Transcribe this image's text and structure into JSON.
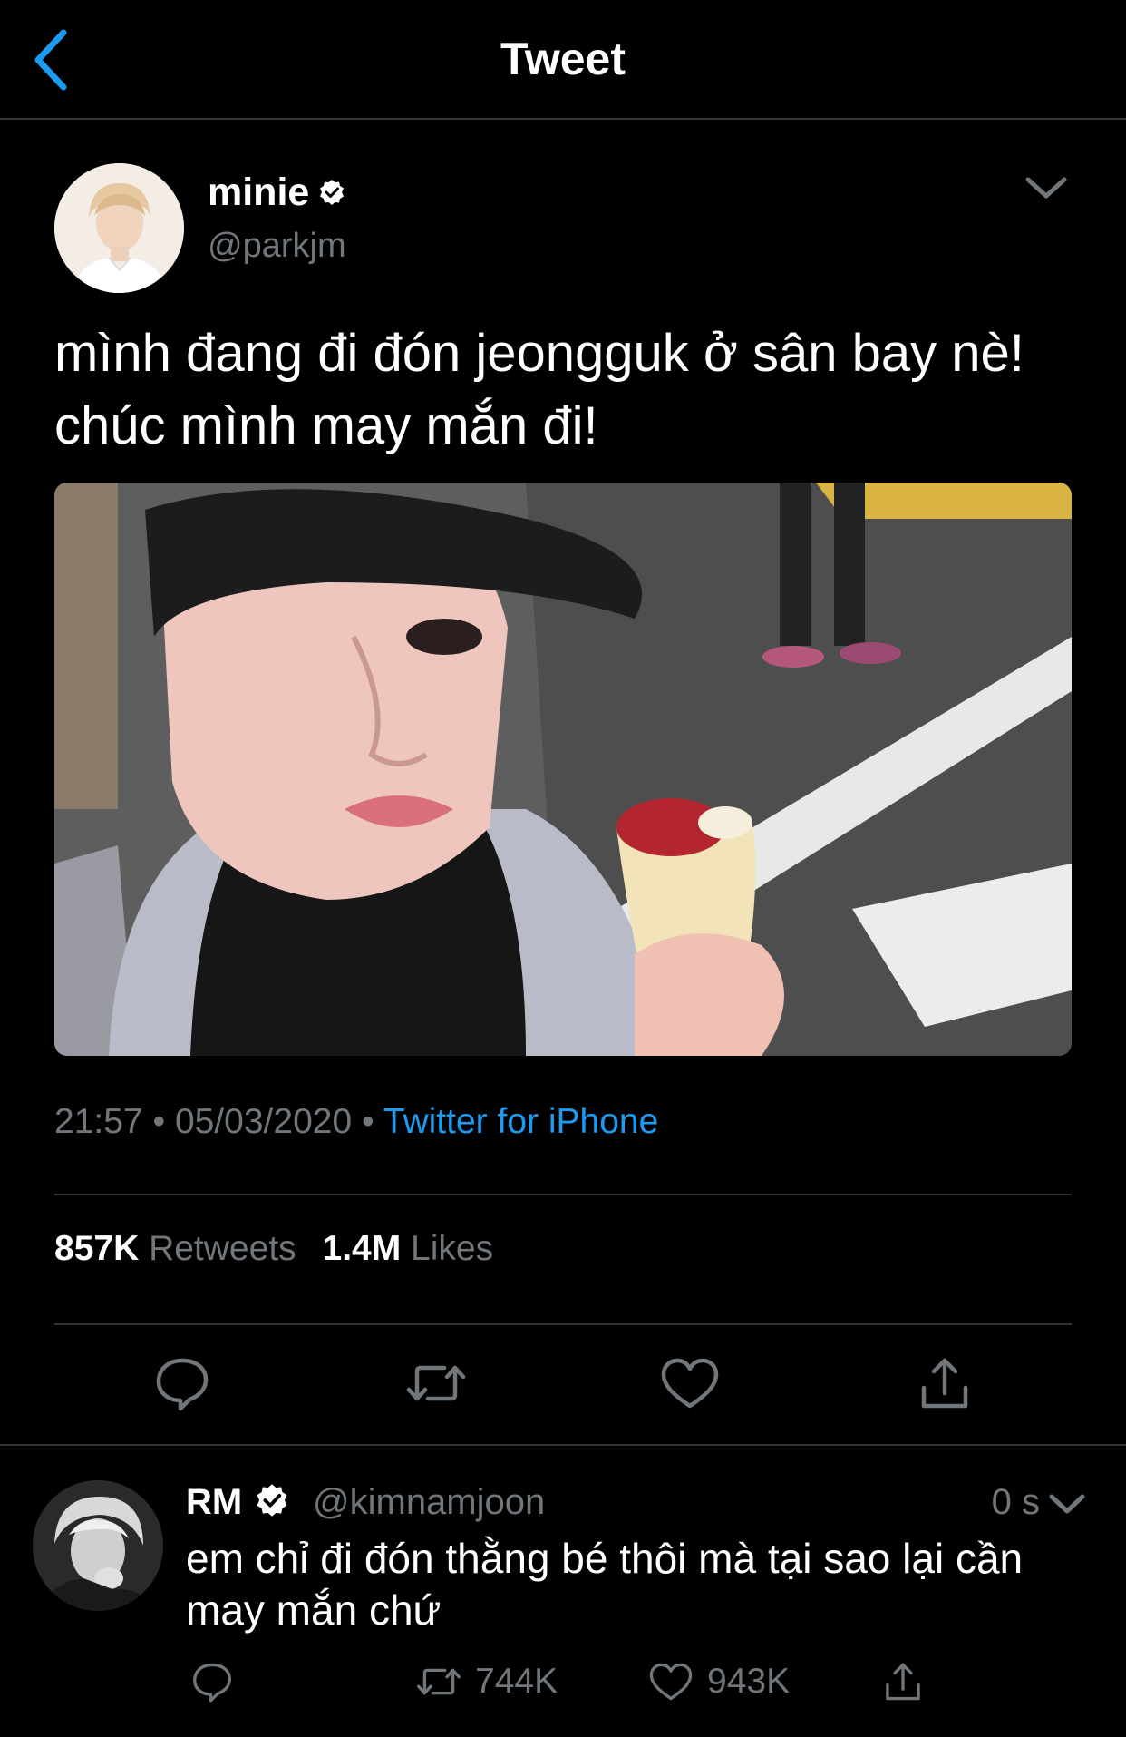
{
  "header": {
    "title": "Tweet"
  },
  "tweet": {
    "author_name": "minie",
    "author_handle": "@parkjm",
    "verified": true,
    "text": "mình đang đi đón jeongguk ở sân bay nè! chúc mình may mắn đi!",
    "time": "21:57",
    "date": "05/03/2020",
    "separator": "•",
    "source": "Twitter for iPhone",
    "retweets_count": "857K",
    "retweets_label": "Retweets",
    "likes_count": "1.4M",
    "likes_label": "Likes"
  },
  "reply": {
    "author_name": "RM",
    "author_handle": "@kimnamjoon",
    "verified": true,
    "time": "0 s",
    "text": "em chỉ đi đón thằng bé thôi mà tại sao lại cần may mắn chứ",
    "retweets_count": "744K",
    "likes_count": "943K"
  },
  "colors": {
    "background": "#000000",
    "accent": "#1d9bf0",
    "muted": "#71767b",
    "divider": "#2f3336"
  },
  "icons": {
    "back": "chevron-left-icon",
    "verified": "verified-badge-icon",
    "caret": "chevron-down-icon",
    "reply": "reply-icon",
    "retweet": "retweet-icon",
    "like": "heart-icon",
    "share": "share-icon"
  }
}
